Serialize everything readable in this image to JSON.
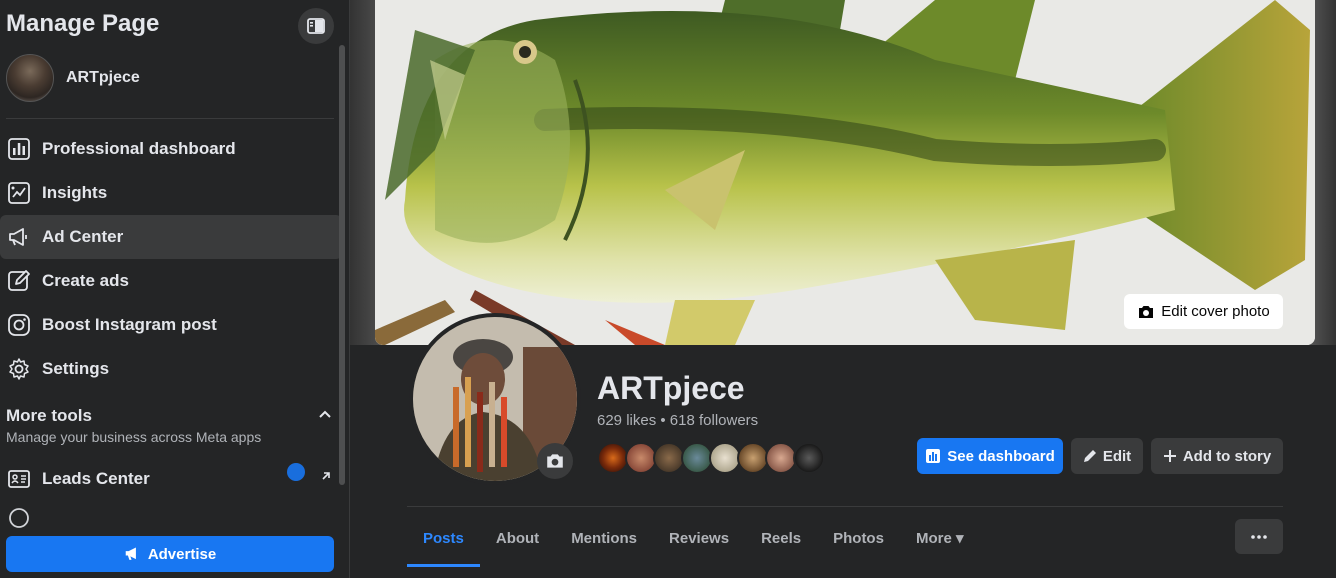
{
  "sidebar": {
    "title": "Manage Page",
    "page_name": "ARTpjece",
    "items": [
      {
        "label": "Professional dashboard",
        "icon": "dashboard-icon"
      },
      {
        "label": "Insights",
        "icon": "insights-icon"
      },
      {
        "label": "Ad Center",
        "icon": "megaphone-icon"
      },
      {
        "label": "Create ads",
        "icon": "pencil-square-icon"
      },
      {
        "label": "Boost Instagram post",
        "icon": "instagram-icon"
      },
      {
        "label": "Settings",
        "icon": "gear-icon"
      }
    ],
    "more_tools": {
      "title": "More tools",
      "subtitle": "Manage your business across Meta apps"
    },
    "leads_label": "Leads Center",
    "advertise_label": "Advertise"
  },
  "profile": {
    "name": "ARTpjece",
    "stats": "629 likes • 618 followers",
    "edit_cover_label": "Edit cover photo",
    "buttons": {
      "see_dashboard": "See dashboard",
      "edit": "Edit",
      "add_to_story": "Add to story"
    }
  },
  "tabs": [
    {
      "label": "Posts"
    },
    {
      "label": "About"
    },
    {
      "label": "Mentions"
    },
    {
      "label": "Reviews"
    },
    {
      "label": "Reels"
    },
    {
      "label": "Photos"
    },
    {
      "label": "More ▾"
    }
  ],
  "colors": {
    "accent": "#1877f2",
    "sidebar_bg": "#242526",
    "page_bg": "#18191a"
  }
}
